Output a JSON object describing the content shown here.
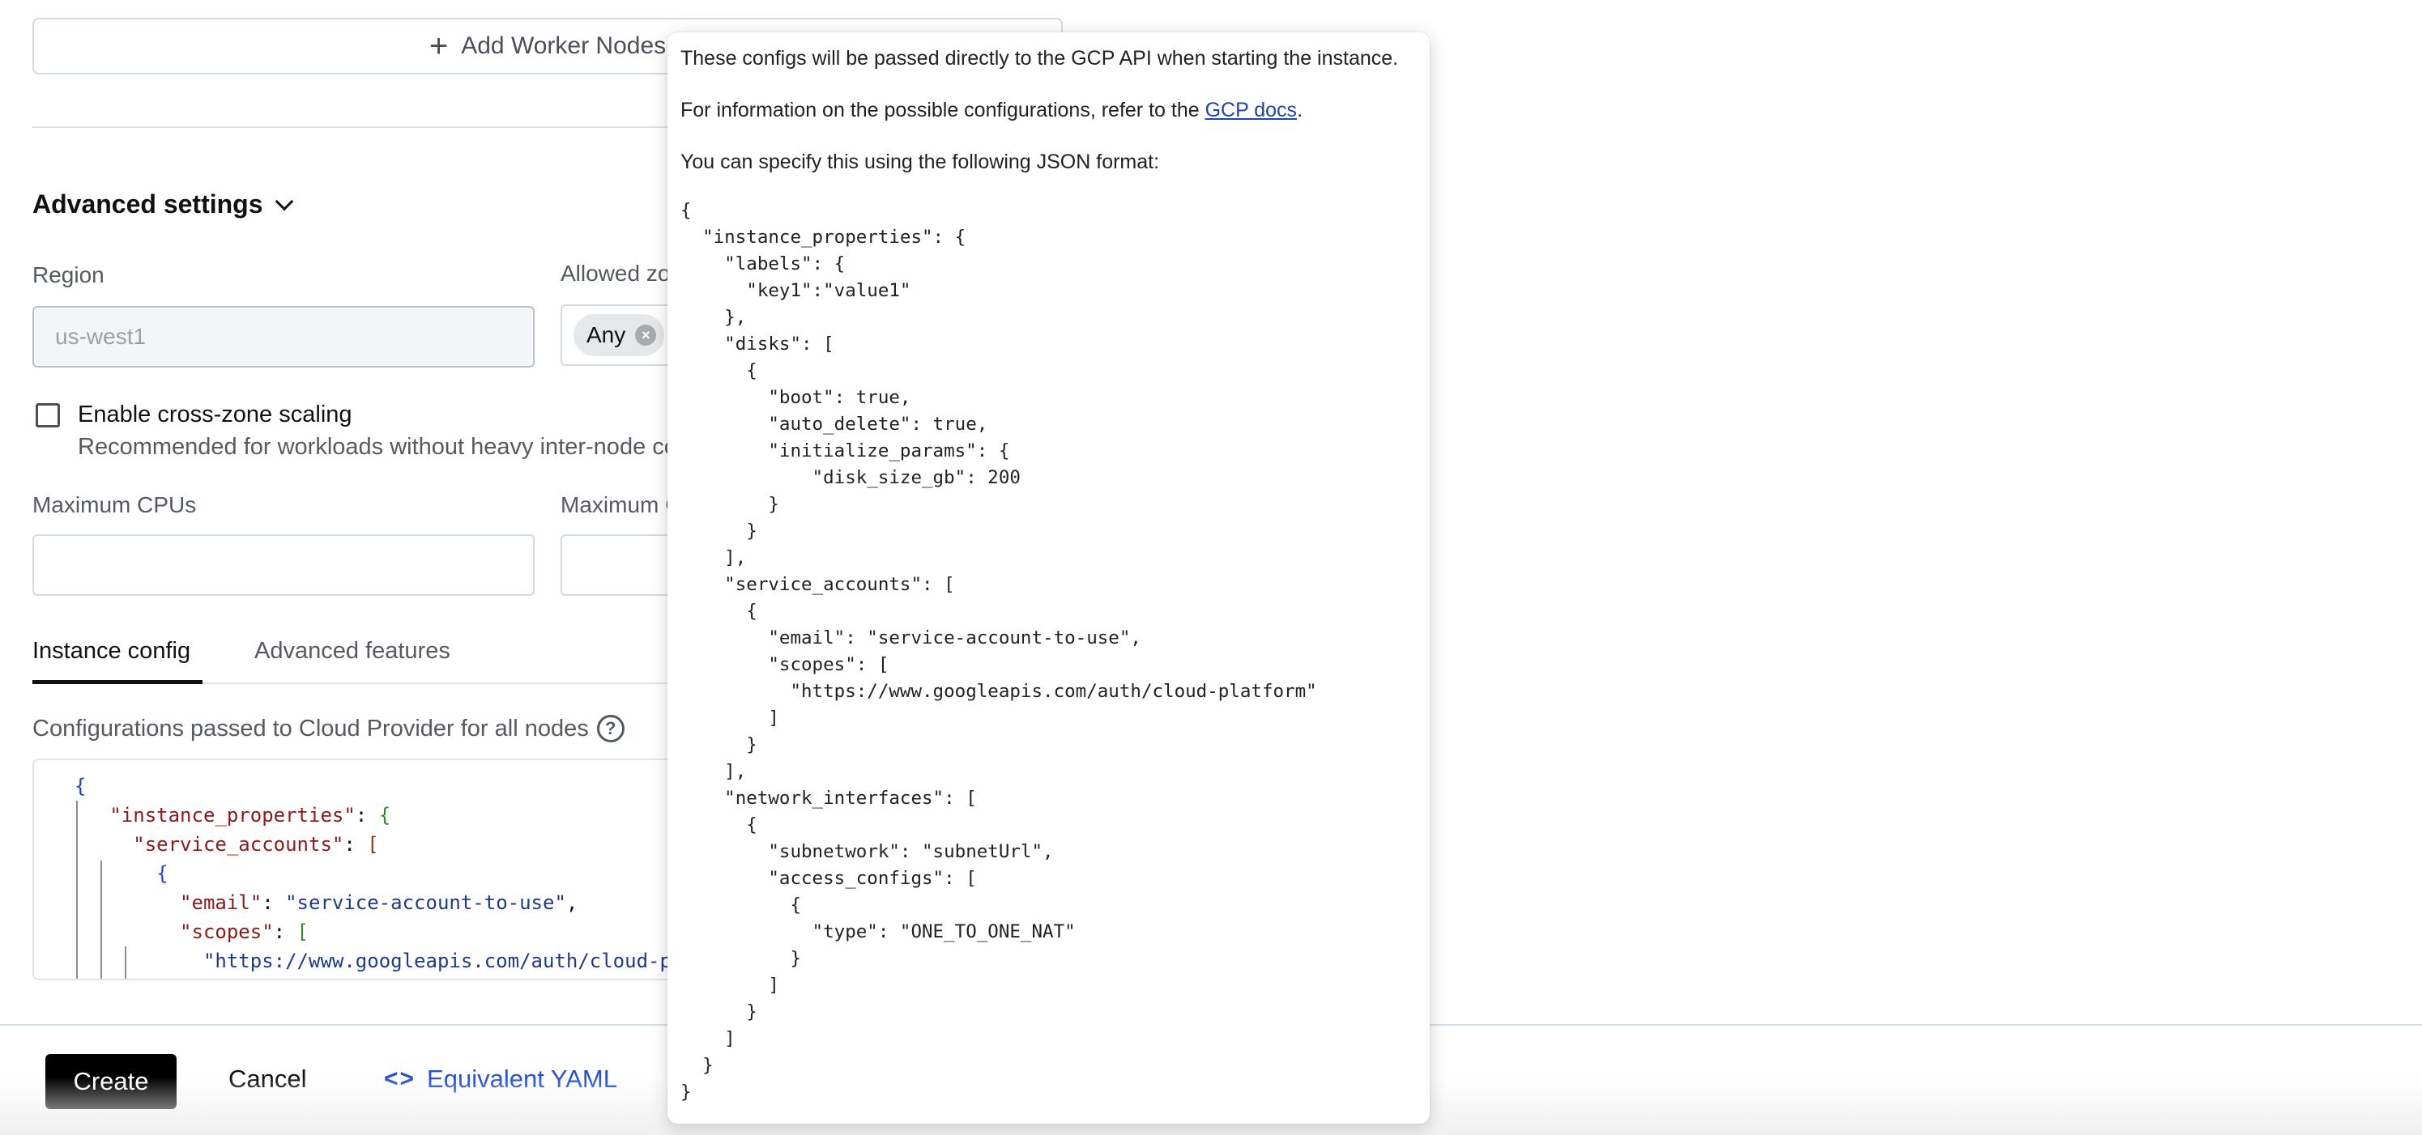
{
  "worker_nodes": {
    "add_label": "Add Worker Nodes",
    "add_icon": "plus-icon"
  },
  "advanced_settings": {
    "title": "Advanced settings",
    "toggle_icon": "chevron-down-icon",
    "region": {
      "label": "Region",
      "value": "us-west1",
      "disabled": true
    },
    "allowed_zones": {
      "label": "Allowed zones",
      "chips": [
        {
          "label": "Any",
          "remove_icon": "close-circle-icon"
        }
      ]
    },
    "cross_zone": {
      "checked": false,
      "label": "Enable cross-zone scaling",
      "description": "Recommended for workloads without heavy inter-node communication"
    },
    "max_cpus": {
      "label": "Maximum CPUs",
      "value": ""
    },
    "max_gpus": {
      "label": "Maximum GPUs",
      "value": ""
    }
  },
  "tabs": [
    {
      "label": "Instance config",
      "active": true
    },
    {
      "label": "Advanced features",
      "active": false
    }
  ],
  "instance_config": {
    "label": "Configurations passed to Cloud Provider for all nodes",
    "help_icon": "question-circle-icon",
    "editor_lines": [
      {
        "indent": 0,
        "parts": [
          [
            "brace1",
            "{"
          ]
        ]
      },
      {
        "indent": 1,
        "parts": [
          [
            "key",
            "\"instance_properties\""
          ],
          [
            "punct",
            ": "
          ],
          [
            "brace2",
            "{"
          ]
        ]
      },
      {
        "indent": 2,
        "parts": [
          [
            "key",
            "\"service_accounts\""
          ],
          [
            "punct",
            ": "
          ],
          [
            "brk",
            "["
          ]
        ]
      },
      {
        "indent": 3,
        "parts": [
          [
            "brace1",
            "{"
          ]
        ]
      },
      {
        "indent": 4,
        "parts": [
          [
            "key",
            "\"email\""
          ],
          [
            "punct",
            ": "
          ],
          [
            "str",
            "\"service-account-to-use\""
          ],
          [
            "punct",
            ","
          ]
        ]
      },
      {
        "indent": 4,
        "parts": [
          [
            "key",
            "\"scopes\""
          ],
          [
            "punct",
            ": "
          ],
          [
            "brace2",
            "["
          ]
        ]
      },
      {
        "indent": 5,
        "parts": [
          [
            "str",
            "\"https://www.googleapis.com/auth/cloud-platform\""
          ]
        ]
      }
    ]
  },
  "footer": {
    "create_label": "Create",
    "cancel_label": "Cancel",
    "yaml_label": "Equivalent YAML",
    "yaml_icon": "code-brackets-icon",
    "colors": {
      "create_bg": "#000000",
      "link": "#2450d6"
    }
  },
  "popover": {
    "line1": "These configs will be passed directly to the GCP API when starting the instance.",
    "line2_prefix": "For information on the possible configurations, refer to the ",
    "line2_link": "GCP docs",
    "line2_suffix": ".",
    "line3": "You can specify this using the following JSON format:",
    "code": "{\n  \"instance_properties\": {\n    \"labels\": {\n      \"key1\":\"value1\"\n    },\n    \"disks\": [\n      {\n        \"boot\": true,\n        \"auto_delete\": true,\n        \"initialize_params\": {\n            \"disk_size_gb\": 200\n        }\n      }\n    ],\n    \"service_accounts\": [\n      {\n        \"email\": \"service-account-to-use\",\n        \"scopes\": [\n          \"https://www.googleapis.com/auth/cloud-platform\"\n        ]\n      }\n    ],\n    \"network_interfaces\": [\n      {\n        \"subnetwork\": \"subnetUrl\",\n        \"access_configs\": [\n          {\n            \"type\": \"ONE_TO_ONE_NAT\"\n          }\n        ]\n      }\n    ]\n  }\n}"
  }
}
